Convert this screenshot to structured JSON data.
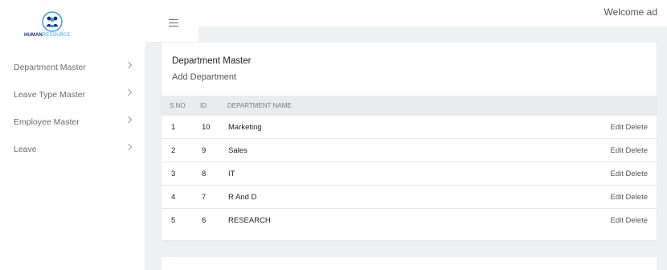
{
  "brand": {
    "logo_text_main": "HUMAN",
    "logo_text_accent": "RESOURCE"
  },
  "header": {
    "welcome": "Welcome ad"
  },
  "sidebar": {
    "items": [
      {
        "label": "Department Master"
      },
      {
        "label": "Leave Type Master"
      },
      {
        "label": "Employee Master"
      },
      {
        "label": "Leave"
      }
    ]
  },
  "main": {
    "title": "Department Master",
    "add_link": "Add Department",
    "table": {
      "headers": [
        "S.NO",
        "ID",
        "DEPARTMENT NAME"
      ],
      "rows": [
        {
          "sno": "1",
          "id": "10",
          "name": "Marketing",
          "edit": "Edit",
          "delete": "Delete"
        },
        {
          "sno": "2",
          "id": "9",
          "name": "Sales",
          "edit": "Edit",
          "delete": "Delete"
        },
        {
          "sno": "3",
          "id": "8",
          "name": "IT",
          "edit": "Edit",
          "delete": "Delete"
        },
        {
          "sno": "4",
          "id": "7",
          "name": "R And D",
          "edit": "Edit",
          "delete": "Delete"
        },
        {
          "sno": "5",
          "id": "6",
          "name": "RESEARCH",
          "edit": "Edit",
          "delete": "Delete"
        }
      ]
    }
  },
  "colors": {
    "accent": "#3aa0dc",
    "brand_dark": "#1b2a6b",
    "page_bg": "#eef1f4"
  }
}
